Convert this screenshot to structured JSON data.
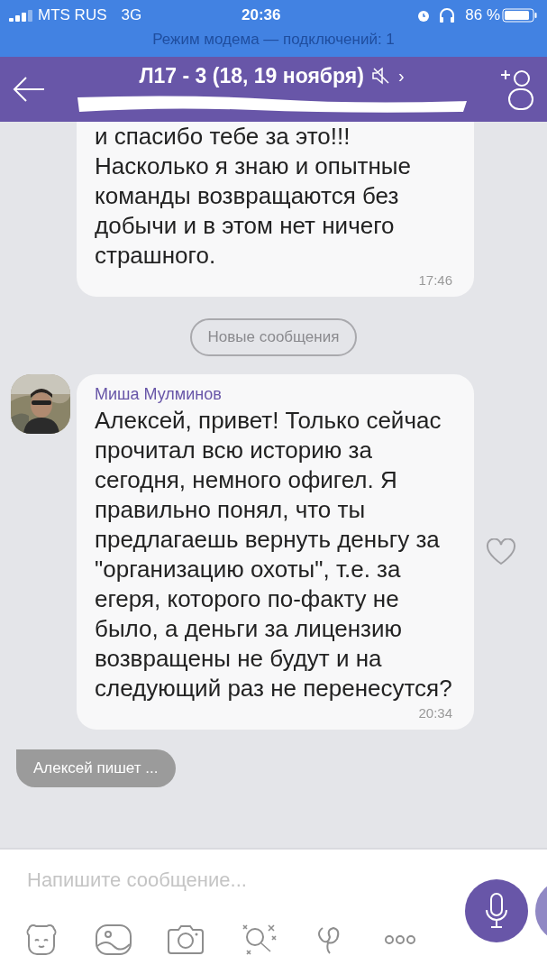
{
  "status_bar": {
    "carrier": "MTS RUS",
    "network": "3G",
    "time": "20:36",
    "battery": "86 %",
    "hotspot": "Режим модема — подключений: 1"
  },
  "header": {
    "title": "Л17 - 3 (18, 19 ноября)",
    "muted": true,
    "chevron": "›"
  },
  "messages": [
    {
      "kind": "text",
      "text": "и спасибо тебе за это!!! Насколько я знаю и опытные команды возвращаются без добычи и в этом нет ничего страшного.",
      "time": "17:46",
      "cut_top": true
    },
    {
      "kind": "divider",
      "label": "Новые сообщения"
    },
    {
      "kind": "text",
      "sender": "Миша Мулминов",
      "text": "Алексей, привет! Только сейчас прочитал всю историю за сегодня, немного офигел. Я правильно понял, что ты предлагаешь вернуть деньгу за \"организацию охоты\", т.е. за егеря, которого по-факту не было, а деньги за лицензию возвращены не будут и на следующий раз не перенесутся?",
      "time": "20:34",
      "liked": false
    }
  ],
  "typing": "Алексей пишет ...",
  "composer": {
    "placeholder": "Напишите сообщение..."
  }
}
